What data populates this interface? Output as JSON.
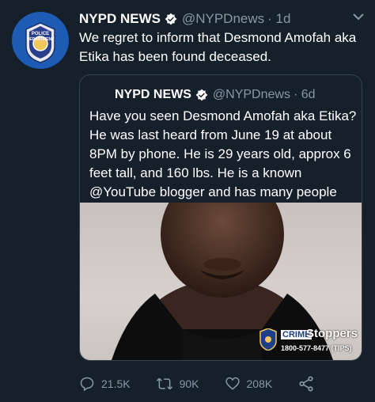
{
  "tweet": {
    "author_name": "NYPD NEWS",
    "handle": "@NYPDnews",
    "time": "· 1d",
    "text": "We regret to inform that Desmond Amofah aka Etika has been found deceased.",
    "avatar_text_top": "POLICE",
    "avatar_text_bottom": "DEPARTMENT"
  },
  "quoted": {
    "author_name": "NYPD NEWS",
    "handle": "@NYPDnews",
    "time": "· 6d",
    "text": "Have you seen Desmond Amofah aka Etika? He was last heard from June 19 at about 8PM by phone. He is 29 years old, approx 6 feet tall, and 160 lbs. He is a known @YouTube blogger and has many people c...",
    "badge_crime": "CRIME",
    "badge_stoppers": "Stoppers",
    "badge_phone": "1800-577-8477 (TIPS)"
  },
  "actions": {
    "replies": "21.5K",
    "retweets": "90K",
    "likes": "208K"
  },
  "colors": {
    "background": "#15202b",
    "muted": "#8899a6",
    "verified": "#ffffff"
  }
}
